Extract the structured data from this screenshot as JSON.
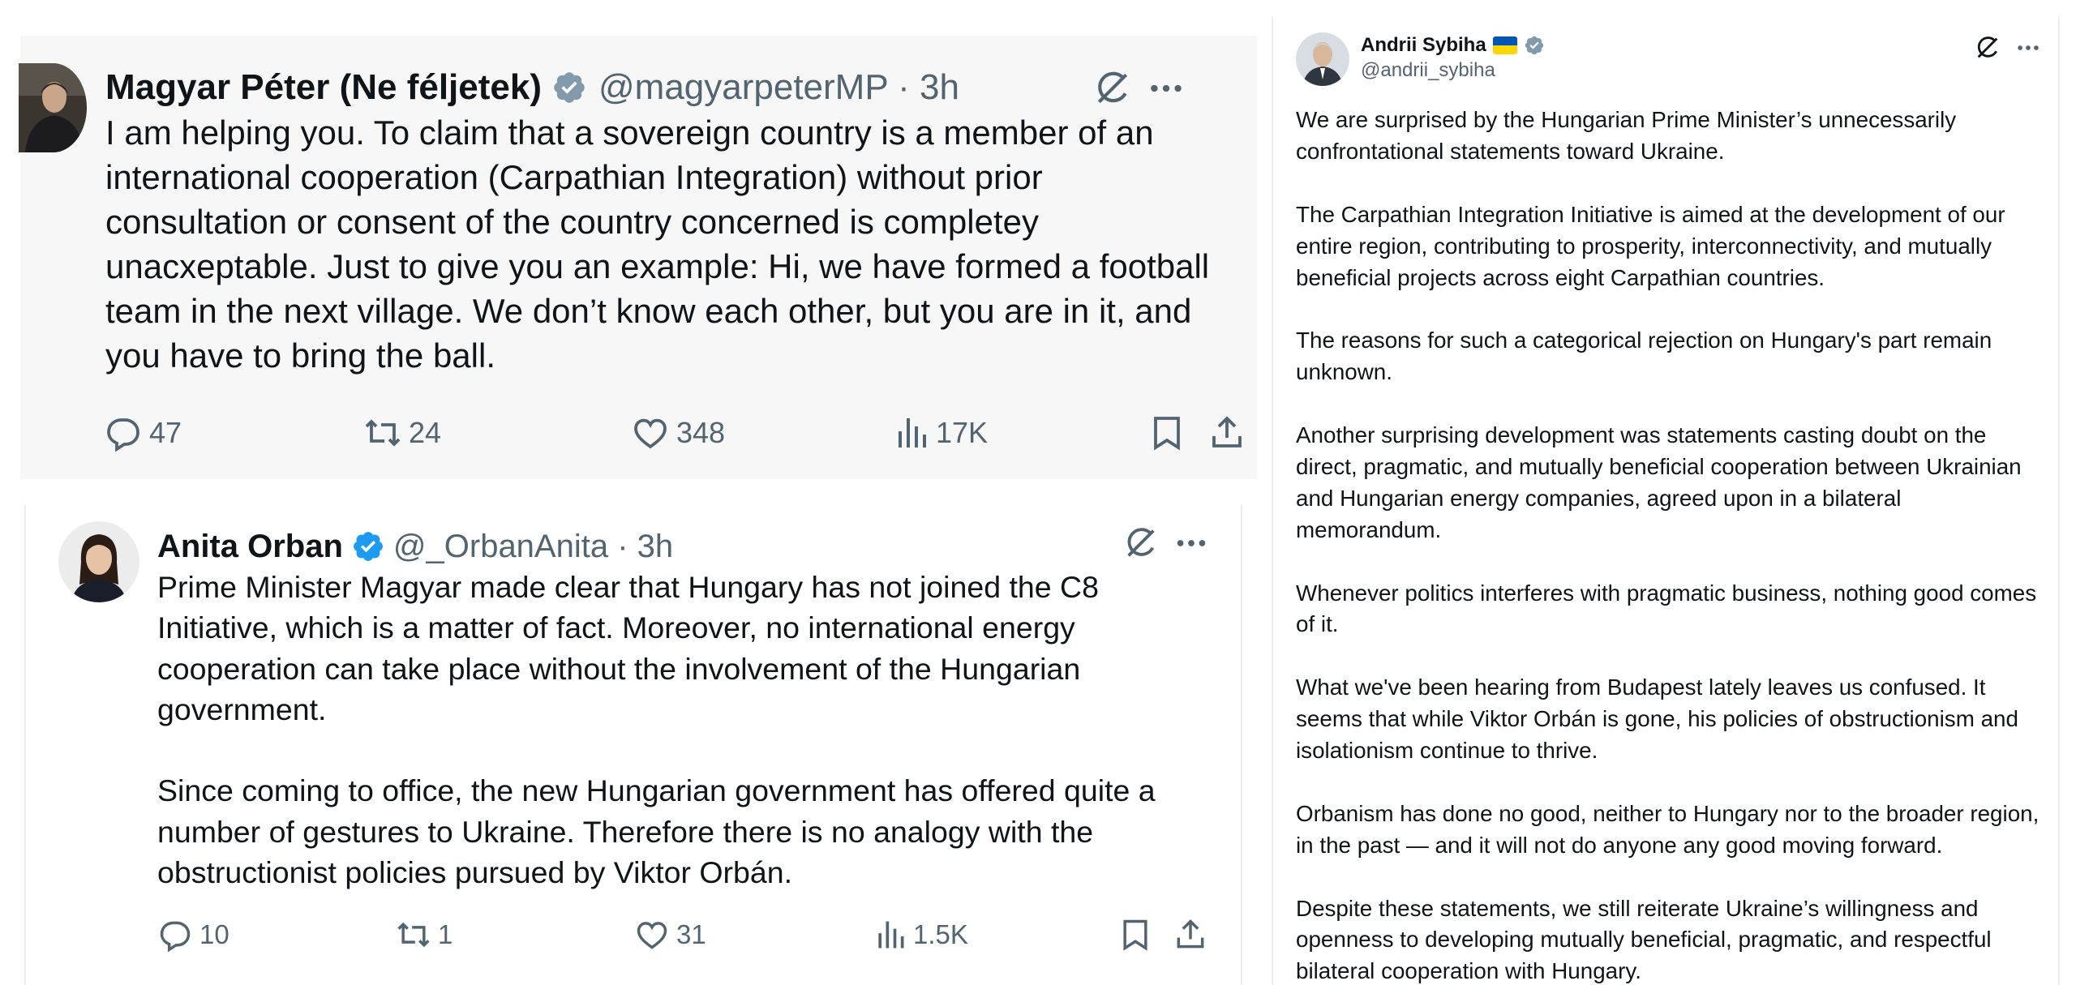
{
  "colors": {
    "background": "#ffffff",
    "tweet1_background": "#f7f7f7",
    "text": "#0f1419",
    "secondary_text": "#536471",
    "verified_blue": "#1d9bf0",
    "verified_gray": "#829aab",
    "flag_blue": "#0057b7",
    "flag_yellow": "#ffd700"
  },
  "tweet1": {
    "author_name": "Magyar Péter (Ne féljetek)",
    "verified_badge": "gray-verified-badge-icon",
    "handle_time": "@magyarpeterMP · 3h",
    "text": "I am helping you. To claim that a sovereign country is a member of an\ninternational cooperation (Carpathian Integration) without prior\nconsultation or consent of the country concerned is completey\nunacxeptable. Just to give you an example: Hi, we have formed a football\nteam in the next village. We don’t know each other, but you are in it, and\nyou have to bring the ball.",
    "replies": "47",
    "reposts": "24",
    "likes": "348",
    "views": "17K",
    "icons": [
      "grok-icon",
      "more-icon",
      "reply-icon",
      "repost-icon",
      "like-icon",
      "views-icon",
      "bookmark-icon",
      "share-icon"
    ]
  },
  "tweet2": {
    "author_name": "Anita Orban",
    "verified_badge": "blue-verified-badge-icon",
    "handle_time": "@_OrbanAnita · 3h",
    "text": "Prime Minister Magyar made clear that Hungary has not joined the C8\nInitiative, which is a matter of fact. Moreover, no international energy\ncooperation can take place without the involvement of the Hungarian\ngovernment.\n\nSince coming to office, the new Hungarian government has offered quite a\nnumber of gestures to Ukraine. Therefore there is no analogy with the\nobstructionist policies pursued by Viktor Orbán.",
    "replies": "10",
    "reposts": "1",
    "likes": "31",
    "views": "1.5K"
  },
  "tweet3": {
    "author_name": "Andrii Sybiha",
    "flag": "ukraine-flag-icon",
    "verified_badge": "gray-verified-badge-icon",
    "handle": "@andrii_sybiha",
    "paragraphs": [
      "We are surprised by the Hungarian Prime Minister’s unnecessarily confrontational statements toward Ukraine.",
      "The Carpathian Integration Initiative is aimed at the development of our entire region, contributing to prosperity, interconnectivity, and mutually beneficial projects across eight Carpathian countries.",
      "The reasons for such a categorical rejection on Hungary's part remain unknown.",
      "Another surprising development was statements casting doubt on the direct, pragmatic, and mutually beneficial cooperation between Ukrainian and Hungarian energy companies, agreed upon in a bilateral memorandum.",
      "Whenever politics interferes with pragmatic business, nothing good comes of it.",
      "What we've been hearing from Budapest lately leaves us confused. It seems that while Viktor Orbán is gone, his policies of obstructionism and isolationism continue to thrive.",
      "Orbanism has done no good, neither to Hungary nor to the broader region, in the past — and it will not do anyone any good moving forward.",
      "Despite these statements, we still reiterate Ukraine’s willingness and openness to developing mutually beneficial, pragmatic, and respectful bilateral cooperation with Hungary."
    ]
  }
}
